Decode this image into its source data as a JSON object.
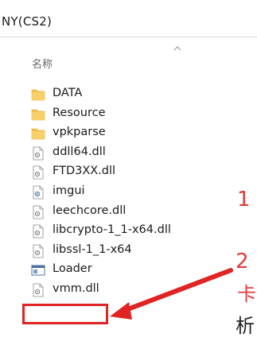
{
  "path_bar": {
    "text": "NY(CS2)"
  },
  "column_header": {
    "name_label": "名称"
  },
  "files": [
    {
      "name": "DATA",
      "icon": "folder-icon",
      "type": "folder"
    },
    {
      "name": "Resource",
      "icon": "folder-icon",
      "type": "folder"
    },
    {
      "name": "vpkparse",
      "icon": "folder-icon",
      "type": "folder"
    },
    {
      "name": "ddll64.dll",
      "icon": "dll-file-icon",
      "type": "dll"
    },
    {
      "name": "FTD3XX.dll",
      "icon": "dll-file-icon",
      "type": "dll"
    },
    {
      "name": "imgui",
      "icon": "settings-file-icon",
      "type": "ini"
    },
    {
      "name": "leechcore.dll",
      "icon": "dll-file-icon",
      "type": "dll"
    },
    {
      "name": "libcrypto-1_1-x64.dll",
      "icon": "dll-file-icon",
      "type": "dll"
    },
    {
      "name": "libssl-1_1-x64",
      "icon": "dll-file-icon",
      "type": "dll"
    },
    {
      "name": "Loader",
      "icon": "application-icon",
      "type": "exe"
    },
    {
      "name": "vmm.dll",
      "icon": "dll-file-icon",
      "type": "dll"
    }
  ],
  "annotations": {
    "step_1": "1",
    "step_2": "2",
    "char_red": "卡",
    "char_black": "析"
  },
  "colors": {
    "folder": "#f2c14e",
    "annotation_red": "#e02424",
    "text": "#1a1a1a"
  }
}
